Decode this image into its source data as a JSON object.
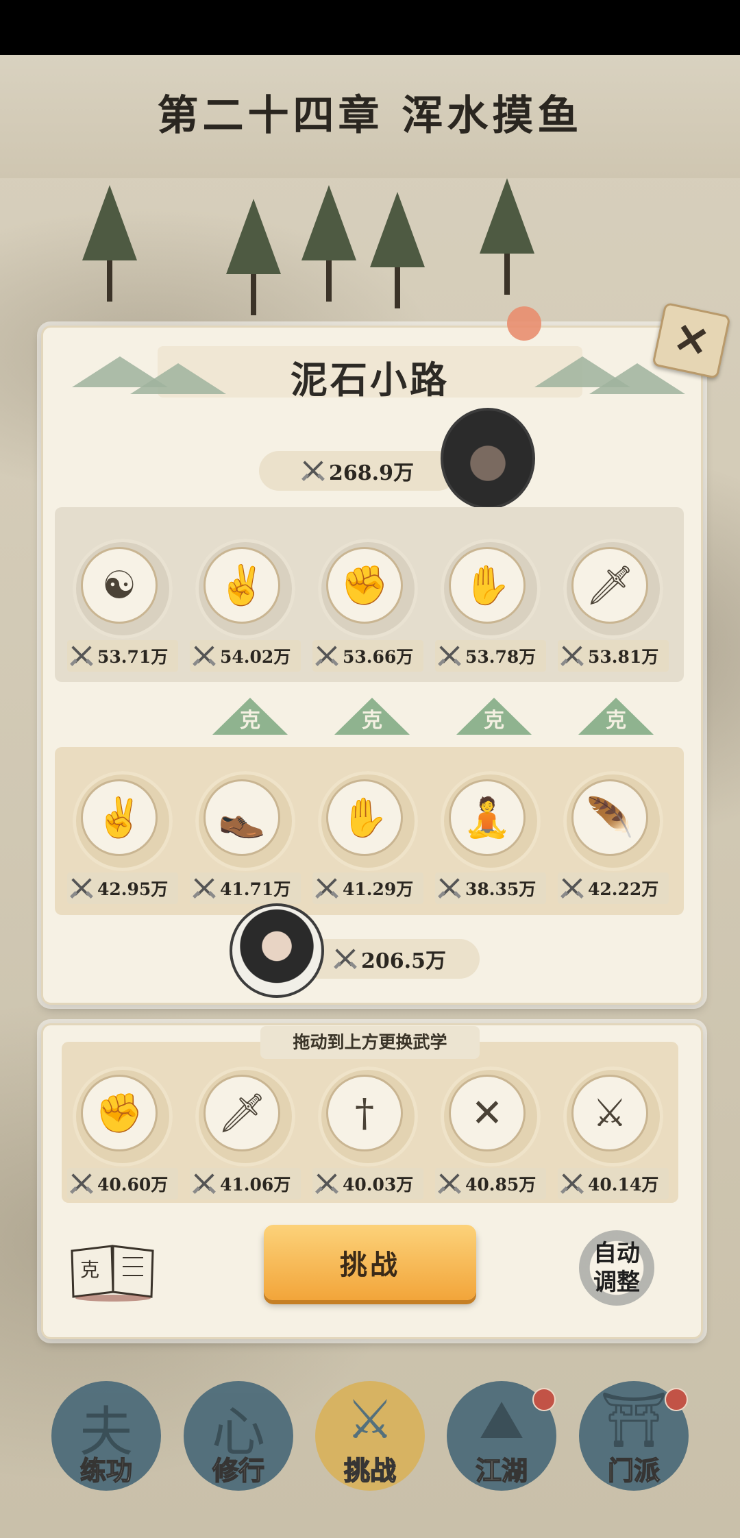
{
  "header": {
    "chapter_title": "第二十四章 浑水摸鱼"
  },
  "stage": {
    "title": "泥石小路",
    "close_icon": "close-x-icon"
  },
  "enemy": {
    "total_power": "268.9万",
    "skills": [
      {
        "name": "yin-yang-icon",
        "glyph": "☯",
        "power": "53.71万"
      },
      {
        "name": "two-finger-icon",
        "glyph": "✌",
        "power": "54.02万"
      },
      {
        "name": "fist-icon",
        "glyph": "✊",
        "power": "53.66万"
      },
      {
        "name": "palm-icon",
        "glyph": "✋",
        "power": "53.78万"
      },
      {
        "name": "sabre-icon",
        "glyph": "🗡",
        "power": "53.81万"
      }
    ]
  },
  "counters": [
    "克",
    "克",
    "克",
    "克"
  ],
  "player": {
    "total_power": "206.5万",
    "skills": [
      {
        "name": "two-finger-icon",
        "glyph": "✌",
        "power": "42.95万"
      },
      {
        "name": "boot-icon",
        "glyph": "👞",
        "power": "41.71万"
      },
      {
        "name": "palm-icon",
        "glyph": "✋",
        "power": "41.29万"
      },
      {
        "name": "meditation-icon",
        "glyph": "🧘",
        "power": "38.35万"
      },
      {
        "name": "feather-icon",
        "glyph": "🪶",
        "power": "42.22万"
      }
    ]
  },
  "inventory": {
    "hint": "拖动到上方更换武学",
    "skills": [
      {
        "name": "fist-icon",
        "glyph": "✊",
        "power": "40.60万"
      },
      {
        "name": "sabre-icon",
        "glyph": "🗡",
        "power": "41.06万"
      },
      {
        "name": "sword-icon",
        "glyph": "†",
        "power": "40.03万"
      },
      {
        "name": "crossed-spears-icon",
        "glyph": "✕",
        "power": "40.85万"
      },
      {
        "name": "darts-icon",
        "glyph": "⚔",
        "power": "40.14万"
      }
    ]
  },
  "actions": {
    "challenge": "挑战",
    "auto_adjust": "自动调整",
    "book_icon": "counter-manual-icon"
  },
  "nav": [
    {
      "label": "练功",
      "glyph": "夫",
      "name": "nav-training",
      "badge": false,
      "active": false
    },
    {
      "label": "修行",
      "glyph": "心",
      "name": "nav-cultivation",
      "badge": false,
      "active": false
    },
    {
      "label": "挑战",
      "glyph": "⚔",
      "name": "nav-challenge",
      "badge": false,
      "active": true
    },
    {
      "label": "江湖",
      "glyph": "⛰",
      "name": "nav-jianghu",
      "badge": true,
      "active": false
    },
    {
      "label": "门派",
      "glyph": "⛩",
      "name": "nav-sect",
      "badge": true,
      "active": false
    }
  ],
  "colors": {
    "accent": "#f2a53a",
    "counter": "#8fb38f",
    "badge": "#c24a3e",
    "nav": "#4b6a79"
  }
}
